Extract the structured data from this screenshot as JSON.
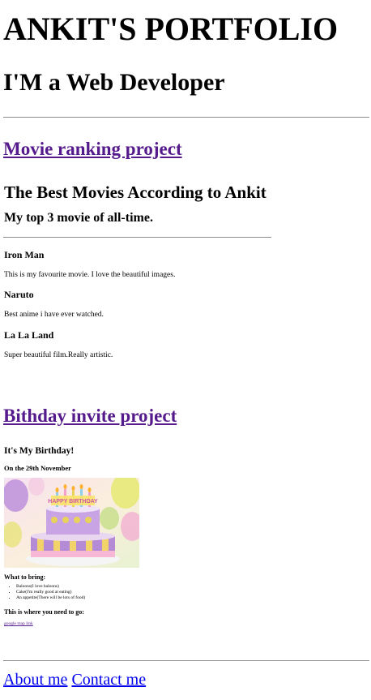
{
  "header": {
    "name": "ANKIT'S PORTFOLIO",
    "role": "I'M a Web Developer"
  },
  "projects": {
    "movie": {
      "link_label": "Movie ranking project",
      "heading": "The Best Movies According to Ankit",
      "subheading": "My top 3 movie of all-time.",
      "movies": [
        {
          "title": "Iron Man",
          "description": "This is my favourite movie. I love the beautiful images."
        },
        {
          "title": "Naruto",
          "description": "Best anime i have ever watched."
        },
        {
          "title": "La La Land",
          "description": "Super beautiful film.Really artistic."
        }
      ]
    },
    "birthday": {
      "link_label": "Bithday invite project",
      "heading": "It's My Birthday!",
      "date": "On the 29th November",
      "bring_heading": "What to bring:",
      "bring_items": [
        "Baloons(I love baloons)",
        "Cake(I'm really good at eating)",
        "An appetite(There will be lots of food)"
      ],
      "where_heading": "This is where you need to go:",
      "map_link": "google map link",
      "cake_banner": "HAPPY BIRTHDAY"
    }
  },
  "footer": {
    "about": "About me",
    "contact": "Contact me"
  }
}
